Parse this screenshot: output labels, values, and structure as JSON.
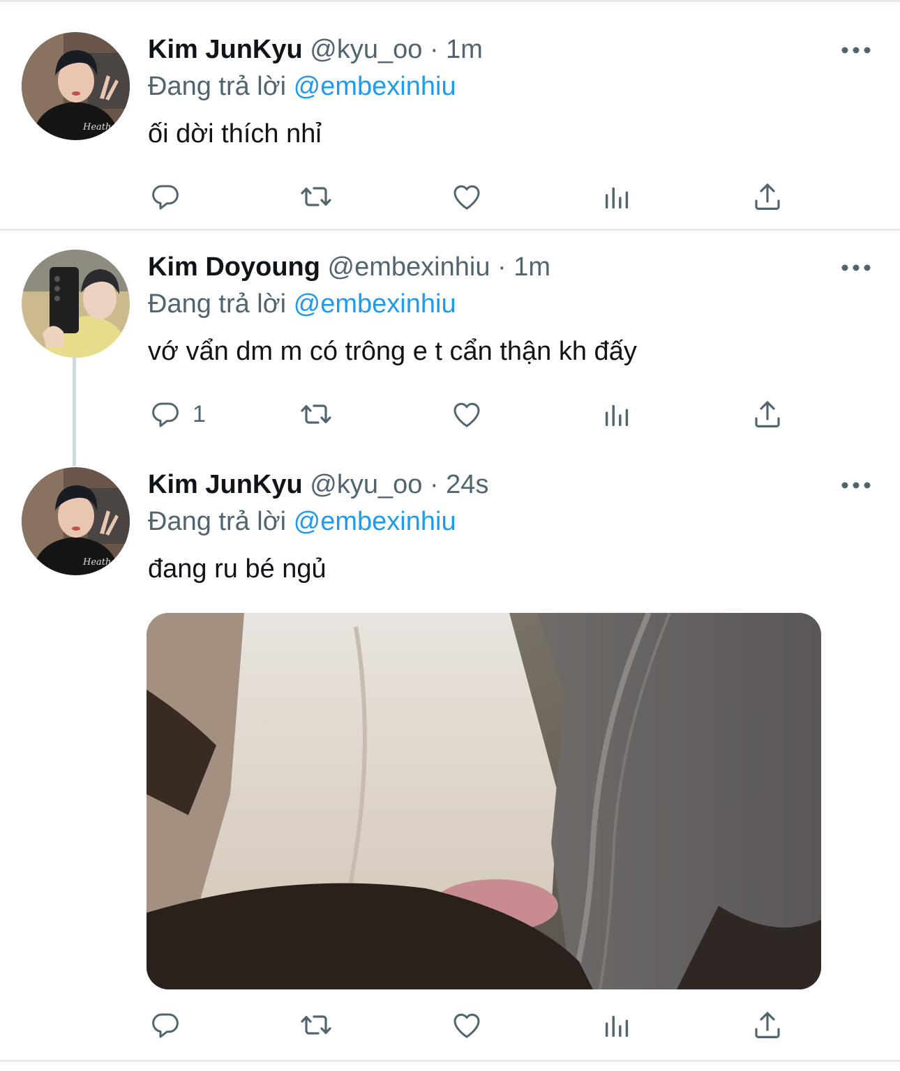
{
  "tweets": [
    {
      "name": "Kim JunKyu",
      "handle": "@kyu_oo",
      "dot": "·",
      "time": "1m",
      "reply_prefix": "Đang trả lời",
      "reply_to": "@embexinhiu",
      "text": "ối dời thích nhỉ",
      "reply_count": ""
    },
    {
      "name": "Kim Doyoung",
      "handle": "@embexinhiu",
      "dot": "·",
      "time": "1m",
      "reply_prefix": "Đang trả lời",
      "reply_to": "@embexinhiu",
      "text": "vớ vẩn dm m có trông e t cẩn thận kh đấy",
      "reply_count": "1"
    },
    {
      "name": "Kim JunKyu",
      "handle": "@kyu_oo",
      "dot": "·",
      "time": "24s",
      "reply_prefix": "Đang trả lời",
      "reply_to": "@embexinhiu",
      "text": "đang ru bé ngủ",
      "reply_count": ""
    }
  ],
  "icons": {
    "reply": "reply-icon",
    "retweet": "retweet-icon",
    "like": "heart-icon",
    "views": "views-icon",
    "share": "share-icon",
    "more": "more-icon"
  },
  "colors": {
    "text": "#0f1419",
    "secondary": "#536471",
    "link": "#1d9bf0",
    "icon": "#536471",
    "separator": "#e6e9ec"
  }
}
